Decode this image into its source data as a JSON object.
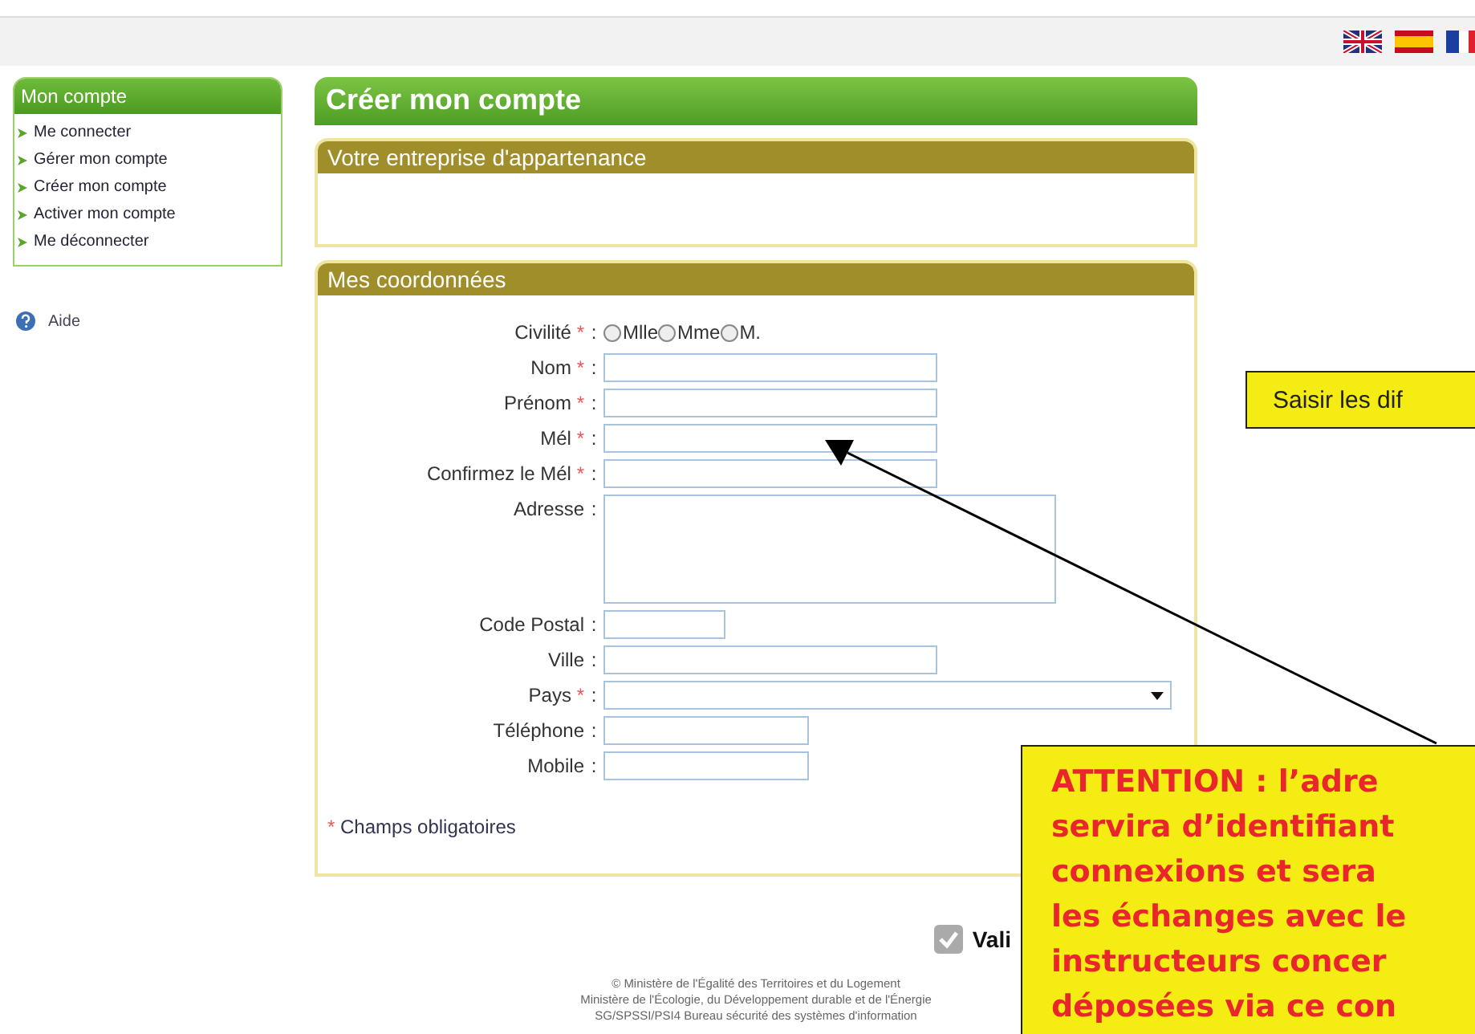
{
  "languages": [
    {
      "kind": "uk"
    },
    {
      "kind": "es"
    },
    {
      "kind": "fr"
    }
  ],
  "sidebar": {
    "title": "Mon compte",
    "items": [
      {
        "label": "Me connecter"
      },
      {
        "label": "Gérer mon compte"
      },
      {
        "label": "Créer mon compte"
      },
      {
        "label": "Activer mon compte"
      },
      {
        "label": "Me déconnecter"
      }
    ],
    "help": "Aide"
  },
  "main": {
    "title": "Créer mon compte",
    "company_section": {
      "title": "Votre entreprise d'appartenance"
    },
    "contact_section": {
      "title": "Mes coordonnées",
      "required_mark": "*",
      "separator": ":",
      "fields": [
        {
          "kind": "radio",
          "label": "Civilité",
          "required": true,
          "options": [
            {
              "label": "Mlle",
              "selected": false
            },
            {
              "label": "Mme",
              "selected": false
            },
            {
              "label": "M.",
              "selected": false
            }
          ]
        },
        {
          "kind": "text",
          "label": "Nom",
          "required": true
        },
        {
          "kind": "text",
          "label": "Prénom",
          "required": true
        },
        {
          "kind": "text",
          "label": "Mél",
          "required": true
        },
        {
          "kind": "text",
          "label": "Confirmez le Mél",
          "required": true
        },
        {
          "kind": "textarea",
          "label": "Adresse",
          "required": false
        },
        {
          "kind": "text",
          "label": "Code Postal",
          "required": false
        },
        {
          "kind": "text",
          "label": "Ville",
          "required": false
        },
        {
          "kind": "select",
          "label": "Pays",
          "required": true
        },
        {
          "kind": "text",
          "label": "Téléphone",
          "required": false
        },
        {
          "kind": "text",
          "label": "Mobile",
          "required": false
        }
      ],
      "required_note": "Champs obligatoires"
    },
    "submit": "Vali"
  },
  "footer": [
    "© Ministère de l'Égalité des Territoires et du Logement",
    "Ministère de l'Écologie, du Développement durable et de l'Énergie",
    "SG/SPSSI/PSI4 Bureau sécurité des systèmes d'information"
  ],
  "callouts": [
    {
      "kind": "note",
      "lines": [
        "Saisir les dif"
      ]
    },
    {
      "kind": "warning",
      "lines": [
        "ATTENTION : l’adre",
        "servira d’identifiant",
        "connexions et sera",
        "les échanges avec le",
        "instructeurs concer",
        "déposées via ce con"
      ]
    }
  ]
}
